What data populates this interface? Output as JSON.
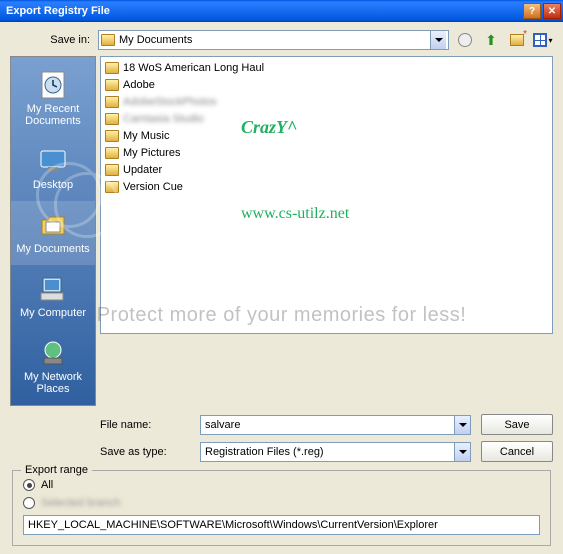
{
  "title": "Export Registry File",
  "savein": {
    "label": "Save in:",
    "value": "My Documents"
  },
  "places": [
    {
      "label": "My Recent Documents"
    },
    {
      "label": "Desktop"
    },
    {
      "label": "My Documents"
    },
    {
      "label": "My Computer"
    },
    {
      "label": "My Network Places"
    }
  ],
  "files": [
    {
      "name": "18 WoS American Long Haul",
      "blurred": false
    },
    {
      "name": "Adobe",
      "blurred": false
    },
    {
      "name": "AdobeStockPhotos",
      "blurred": true
    },
    {
      "name": "Camtasia Studio",
      "blurred": true
    },
    {
      "name": "My Music",
      "blurred": false
    },
    {
      "name": "My Pictures",
      "blurred": false
    },
    {
      "name": "Updater",
      "blurred": false
    },
    {
      "name": "Version Cue",
      "blurred": false
    }
  ],
  "watermark1": "CrazY^",
  "watermark2": "www.cs-utilz.net",
  "pbwatermark": "Protect more of your memories for less!",
  "filename": {
    "label": "File name:",
    "value": "salvare"
  },
  "saveas": {
    "label": "Save as type:",
    "value": "Registration Files (*.reg)"
  },
  "buttons": {
    "save": "Save",
    "cancel": "Cancel"
  },
  "export": {
    "legend": "Export range",
    "all": "All",
    "selected": "Selected branch",
    "path": "HKEY_LOCAL_MACHINE\\SOFTWARE\\Microsoft\\Windows\\CurrentVersion\\Explorer"
  }
}
